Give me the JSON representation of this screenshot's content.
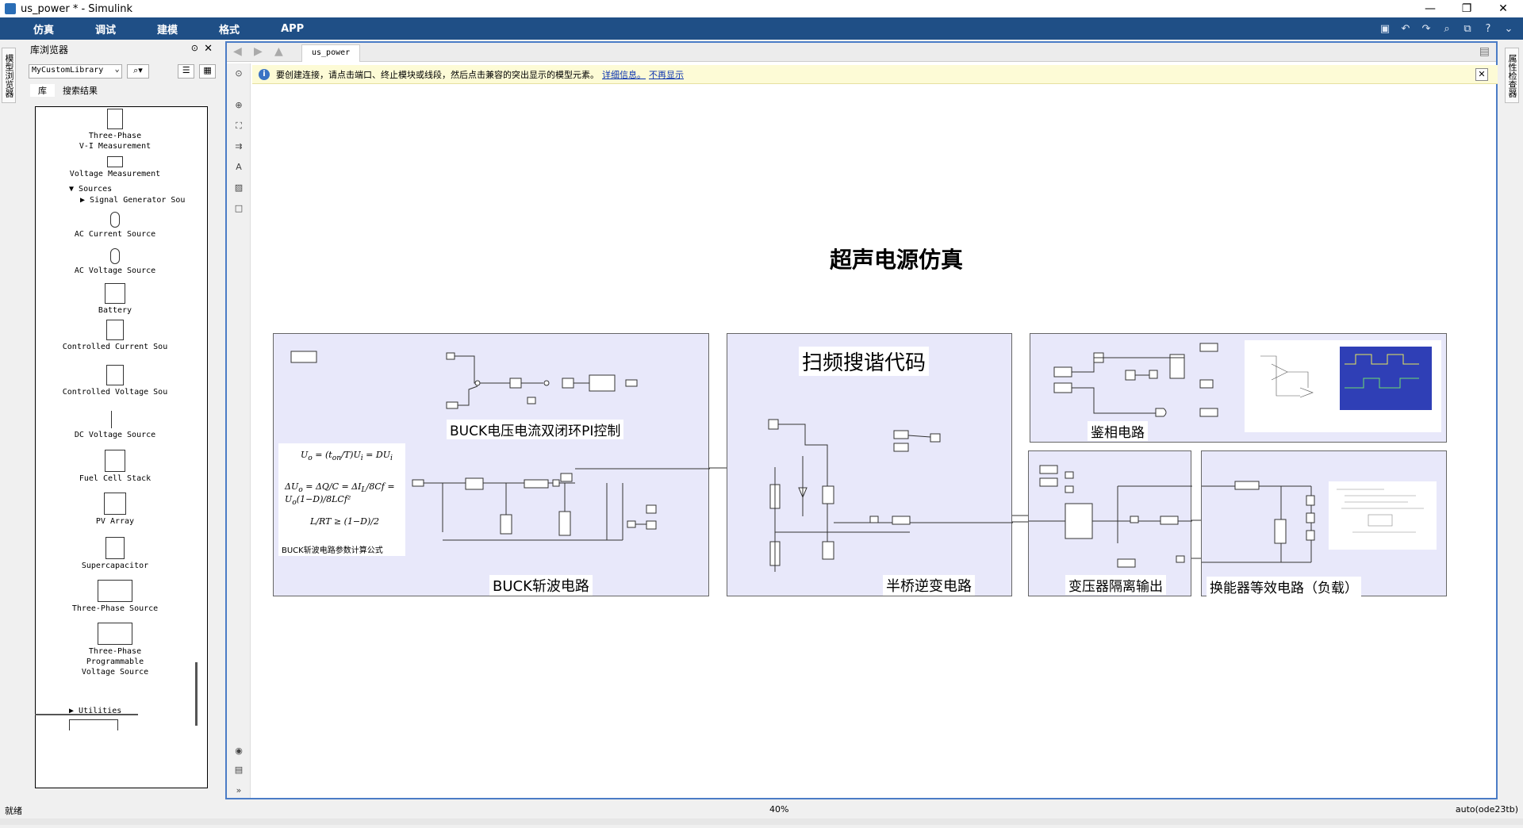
{
  "window": {
    "title": "us_power * - Simulink",
    "controls": [
      "—",
      "❐",
      "✕"
    ]
  },
  "menu": [
    "仿真",
    "调试",
    "建模",
    "格式",
    "APP"
  ],
  "quick_access": [
    "save-icon",
    "undo-icon",
    "redo-icon",
    "zoom-icon",
    "find-icon",
    "help-icon"
  ],
  "side_tabs": {
    "left": "模型浏览器",
    "right": "属性检查器"
  },
  "library": {
    "header": "库浏览器",
    "selected_library": "MyCustomLibrary",
    "tabs": [
      "库",
      "搜索结果"
    ],
    "items": [
      {
        "label": "Three-Phase\nV-I Measurement"
      },
      {
        "label": "Voltage Measurement"
      },
      {
        "label": "Sources",
        "node": "expanded"
      },
      {
        "label": "Signal Generator Sou",
        "node": "collapsed"
      },
      {
        "label": "AC Current Source"
      },
      {
        "label": "AC Voltage Source"
      },
      {
        "label": "Battery"
      },
      {
        "label": "Controlled Current Sou"
      },
      {
        "label": "Controlled Voltage Sou"
      },
      {
        "label": "DC Voltage Source"
      },
      {
        "label": "Fuel Cell Stack"
      },
      {
        "label": "PV Array"
      },
      {
        "label": "Supercapacitor"
      },
      {
        "label": "Three-Phase Source"
      },
      {
        "label": "Three-Phase\nProgrammable\nVoltage Source"
      },
      {
        "label": "Utilities",
        "node": "collapsed"
      }
    ]
  },
  "canvas": {
    "tab": "us_power",
    "info": {
      "text": "要创建连接，请点击端口、终止模块或线段，然后点击兼容的突出显示的模型元素。",
      "link1": "详细信息。",
      "link2": "不再显示"
    },
    "title": "超声电源仿真",
    "areas": {
      "buck_pi": "BUCK电压电流双闭环PI控制",
      "buck_formula": "BUCK斩波电路参数计算公式",
      "buck": "BUCK斩波电路",
      "sweep": "扫频搜谐代码",
      "half_bridge": "半桥逆变电路",
      "phase": "鉴相电路",
      "transformer": "变压器隔离输出",
      "load": "换能器等效电路（负载）"
    }
  },
  "status": {
    "left": "就绪",
    "zoom": "40%",
    "solver": "auto(ode23tb)"
  },
  "colors": {
    "menubar": "#1f4f86",
    "area_fill": "#e8e8fa",
    "info_bg": "#fdfbd6"
  }
}
